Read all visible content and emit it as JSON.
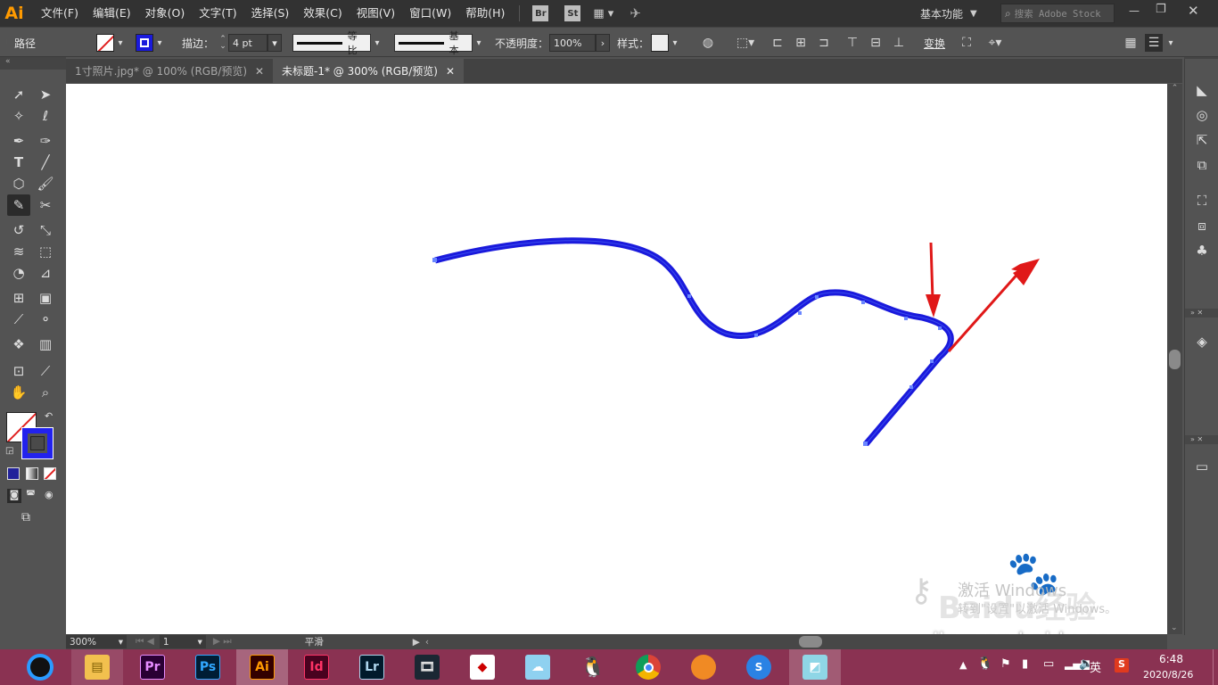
{
  "app": {
    "logo": "Ai"
  },
  "menu": [
    "文件(F)",
    "编辑(E)",
    "对象(O)",
    "文字(T)",
    "选择(S)",
    "效果(C)",
    "视图(V)",
    "窗口(W)",
    "帮助(H)"
  ],
  "menubar_right": {
    "bridge": "Br",
    "stock": "St",
    "workspace": "基本功能",
    "search_placeholder": "搜索 Adobe Stock"
  },
  "control": {
    "object_type": "路径",
    "stroke_label": "描边：",
    "stroke_weight": "4 pt",
    "profile_label": "等比",
    "brush_label": "基本",
    "opacity_label": "不透明度：",
    "opacity_value": "100%",
    "style_label": "样式：",
    "transform_label": "变换"
  },
  "tabs": [
    {
      "label": "1寸照片.jpg* @ 100% (RGB/预览)",
      "active": false
    },
    {
      "label": "未标题-1* @ 300% (RGB/预览)",
      "active": true
    }
  ],
  "toolbox": {
    "tools": [
      "selection-icon",
      "direct-selection-icon",
      "magic-wand-icon",
      "lasso-icon",
      "pen-icon",
      "curvature-icon",
      "type-icon",
      "line-icon",
      "polygon-icon",
      "paintbrush-icon",
      "shaper-icon",
      "scissors-icon",
      "rotate-icon",
      "scale-icon",
      "warp-icon",
      "free-transform-icon",
      "shape-builder-icon",
      "perspective-grid-icon",
      "mesh-icon",
      "gradient-icon",
      "eyedropper-icon",
      "blend-icon",
      "symbol-sprayer-icon",
      "graph-icon",
      "artboard-icon",
      "slice-icon",
      "hand-icon",
      "zoom-icon"
    ],
    "fill_color": "none",
    "stroke_color": "#2222ee"
  },
  "canvas": {
    "path_color": "#1a1adc",
    "arrow_color": "#e01818",
    "watermark_line1": "激活 Windows",
    "watermark_line2": "转到\"设置\"以激活 Windows。",
    "brand_watermark": "Baidu经验",
    "site_watermark": "jingyan.baidu.com"
  },
  "status": {
    "zoom": "300%",
    "artboard": "1",
    "tool_name": "平滑"
  },
  "taskbar": {
    "apps": [
      "Pr",
      "Ps",
      "Ai",
      "Id",
      "Lr"
    ],
    "tray_lang": "英",
    "time": "6:48",
    "date": "2020/8/26"
  },
  "colors": {
    "menubar": "#323232",
    "panel": "#535353",
    "taskbar": "#8a3252",
    "accent": "#ff9a00"
  }
}
